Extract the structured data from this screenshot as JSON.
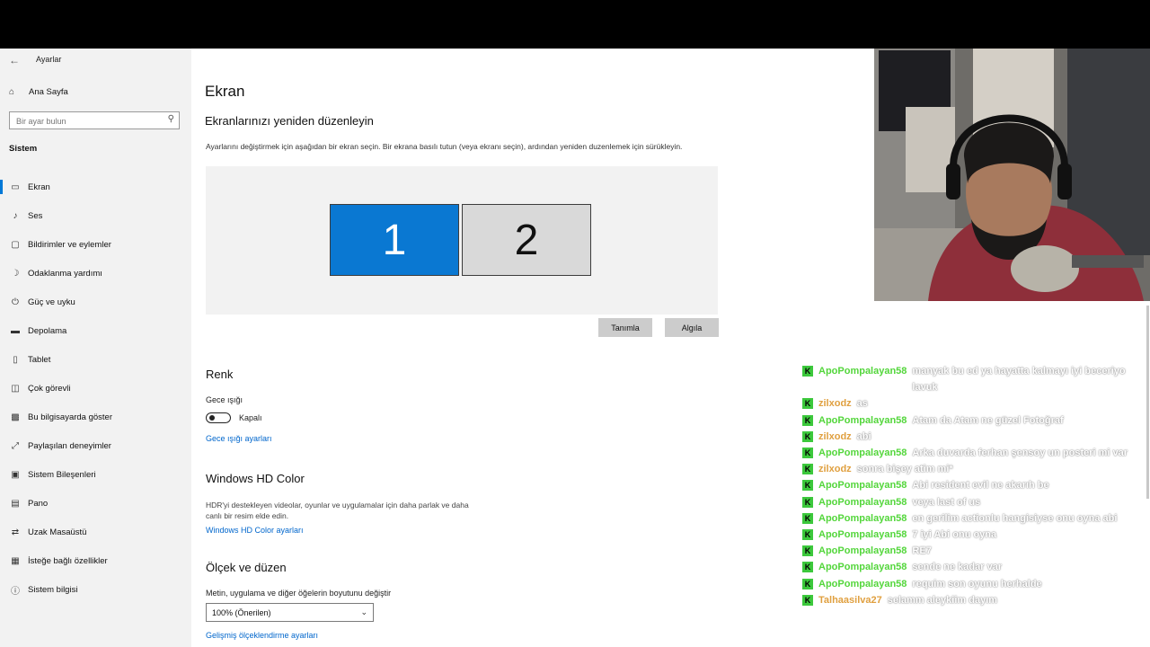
{
  "window": {
    "title": "Ayarlar",
    "back_icon": "back-arrow-icon"
  },
  "sidebar": {
    "home": "Ana Sayfa",
    "search_placeholder": "Bir ayar bulun",
    "section": "Sistem",
    "items": [
      {
        "label": "Ekran",
        "icon": "monitor-icon",
        "active": true
      },
      {
        "label": "Ses",
        "icon": "speaker-icon"
      },
      {
        "label": "Bildirimler ve eylemler",
        "icon": "notification-icon"
      },
      {
        "label": "Odaklanma yardımı",
        "icon": "moon-icon"
      },
      {
        "label": "Güç ve uyku",
        "icon": "power-icon"
      },
      {
        "label": "Depolama",
        "icon": "storage-icon"
      },
      {
        "label": "Tablet",
        "icon": "tablet-icon"
      },
      {
        "label": "Çok görevli",
        "icon": "multitask-icon"
      },
      {
        "label": "Bu bilgisayarda göster",
        "icon": "project-icon"
      },
      {
        "label": "Paylaşılan deneyimler",
        "icon": "share-icon"
      },
      {
        "label": "Sistem Bileşenleri",
        "icon": "components-icon"
      },
      {
        "label": "Pano",
        "icon": "clipboard-icon"
      },
      {
        "label": "Uzak Masaüstü",
        "icon": "remote-icon"
      },
      {
        "label": "İsteğe bağlı özellikler",
        "icon": "features-icon"
      },
      {
        "label": "Sistem bilgisi",
        "icon": "info-icon"
      }
    ]
  },
  "main": {
    "title": "Ekran",
    "subtitle": "Ekranlarınızı yeniden düzenleyin",
    "description": "Ayarlarını değiştirmek için aşağıdan bir ekran seçin. Bir ekrana basılı tutun (veya ekranı seçin), ardından yeniden duzenlemek için sürükleyin.",
    "monitors": [
      "1",
      "2"
    ],
    "identify": "Tanımla",
    "detect": "Algıla",
    "color": {
      "heading": "Renk",
      "night_light": "Gece ışığı",
      "toggle_state": "Kapalı",
      "link": "Gece ışığı ayarları"
    },
    "hdr": {
      "heading": "Windows HD Color",
      "description": "HDR'yi destekleyen videolar, oyunlar ve uygulamalar için daha parlak ve daha canlı bir resim elde edin.",
      "link": "Windows HD Color ayarları"
    },
    "scale": {
      "heading": "Ölçek ve düzen",
      "label": "Metin, uygulama ve diğer öğelerin boyutunu değiştir",
      "value": "100% (Önerilen)",
      "link": "Gelişmiş ölçeklendirme ayarları"
    }
  },
  "chat": [
    {
      "user": "ApoPompalayan58",
      "text": "manyak bu ed ya hayatta kalmayı iyi beceriyo lavuk",
      "color": "#53d63b"
    },
    {
      "user": "zilxodz",
      "text": "as",
      "color": "#e0a040"
    },
    {
      "user": "ApoPompalayan58",
      "text": "Atam da Atam ne güzel Fotoğraf",
      "color": "#53d63b"
    },
    {
      "user": "zilxodz",
      "text": "abi",
      "color": "#e0a040"
    },
    {
      "user": "ApoPompalayan58",
      "text": "Arka duvarda ferhan şensoy un posteri mi var",
      "color": "#53d63b"
    },
    {
      "user": "zilxodz",
      "text": "sonra bişey atim mi*",
      "color": "#e0a040"
    },
    {
      "user": "ApoPompalayan58",
      "text": "Abi resident evil ne akarıh be",
      "color": "#53d63b"
    },
    {
      "user": "ApoPompalayan58",
      "text": "veya last of us",
      "color": "#53d63b"
    },
    {
      "user": "ApoPompalayan58",
      "text": "en gerilim actionlu hangisiyse onu oyna abi",
      "color": "#53d63b"
    },
    {
      "user": "ApoPompalayan58",
      "text": "7 iyi Abi onu oyna",
      "color": "#53d63b"
    },
    {
      "user": "ApoPompalayan58",
      "text": "RE7",
      "color": "#53d63b"
    },
    {
      "user": "ApoPompalayan58",
      "text": "sende ne kadar var",
      "color": "#53d63b"
    },
    {
      "user": "ApoPompalayan58",
      "text": "requim son oyunu herhalde",
      "color": "#53d63b"
    },
    {
      "user": "Talhaasilva27",
      "text": "selamm aleykiim dayım",
      "color": "#e0a040"
    }
  ]
}
